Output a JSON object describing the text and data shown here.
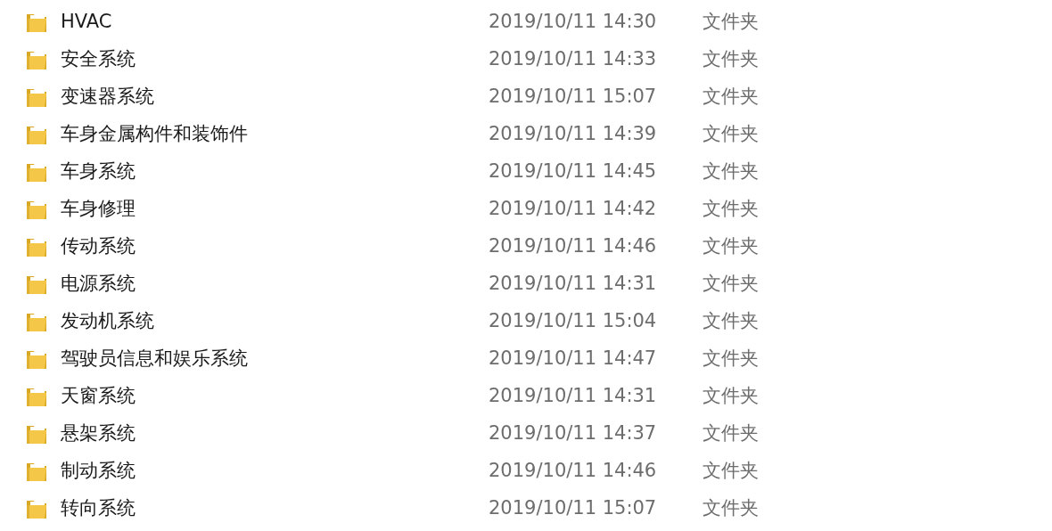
{
  "files": [
    {
      "name": "HVAC",
      "modified": "2019/10/11 14:30",
      "type": "文件夹"
    },
    {
      "name": "安全系统",
      "modified": "2019/10/11 14:33",
      "type": "文件夹"
    },
    {
      "name": "变速器系统",
      "modified": "2019/10/11 15:07",
      "type": "文件夹"
    },
    {
      "name": "车身金属构件和装饰件",
      "modified": "2019/10/11 14:39",
      "type": "文件夹"
    },
    {
      "name": "车身系统",
      "modified": "2019/10/11 14:45",
      "type": "文件夹"
    },
    {
      "name": "车身修理",
      "modified": "2019/10/11 14:42",
      "type": "文件夹"
    },
    {
      "name": "传动系统",
      "modified": "2019/10/11 14:46",
      "type": "文件夹"
    },
    {
      "name": "电源系统",
      "modified": "2019/10/11 14:31",
      "type": "文件夹"
    },
    {
      "name": "发动机系统",
      "modified": "2019/10/11 15:04",
      "type": "文件夹"
    },
    {
      "name": "驾驶员信息和娱乐系统",
      "modified": "2019/10/11 14:47",
      "type": "文件夹"
    },
    {
      "name": "天窗系统",
      "modified": "2019/10/11 14:31",
      "type": "文件夹"
    },
    {
      "name": "悬架系统",
      "modified": "2019/10/11 14:37",
      "type": "文件夹"
    },
    {
      "name": "制动系统",
      "modified": "2019/10/11 14:46",
      "type": "文件夹"
    },
    {
      "name": "转向系统",
      "modified": "2019/10/11 15:07",
      "type": "文件夹"
    }
  ]
}
